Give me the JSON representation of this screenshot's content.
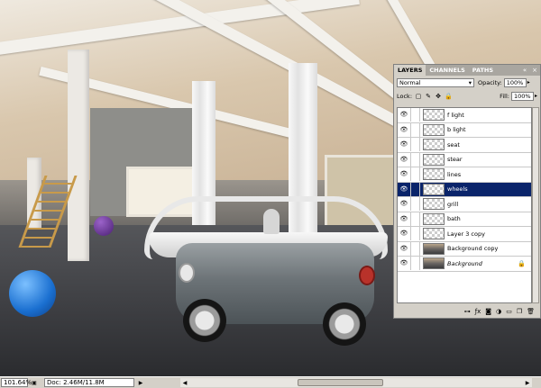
{
  "layers_panel": {
    "tabs": [
      {
        "label": "LAYERS",
        "active": true
      },
      {
        "label": "CHANNELS",
        "active": false
      },
      {
        "label": "PATHS",
        "active": false
      }
    ],
    "blend_mode": "Normal",
    "opacity_label": "Opacity:",
    "opacity_value": "100%",
    "lock_label": "Lock:",
    "fill_label": "Fill:",
    "fill_value": "100%",
    "layers": [
      {
        "name": "f light",
        "thumb": "transparent",
        "selected": false
      },
      {
        "name": "b light",
        "thumb": "transparent",
        "selected": false
      },
      {
        "name": "seat",
        "thumb": "transparent",
        "selected": false
      },
      {
        "name": "stear",
        "thumb": "transparent",
        "selected": false
      },
      {
        "name": "lines",
        "thumb": "transparent",
        "selected": false
      },
      {
        "name": "wheels",
        "thumb": "transparent",
        "selected": true
      },
      {
        "name": "grill",
        "thumb": "transparent",
        "selected": false
      },
      {
        "name": "bath",
        "thumb": "transparent",
        "selected": false
      },
      {
        "name": "Layer 3 copy",
        "thumb": "transparent",
        "selected": false
      },
      {
        "name": "Background copy",
        "thumb": "image",
        "selected": false
      },
      {
        "name": "Background",
        "thumb": "image",
        "selected": false,
        "italic": true,
        "locked": true
      }
    ],
    "bottom_icons": [
      "link-icon",
      "fx-icon",
      "mask-icon",
      "adjustment-icon",
      "folder-icon",
      "new-layer-icon",
      "trash-icon"
    ]
  },
  "status_bar": {
    "zoom": "101.64%",
    "doc_info": "Doc: 2.46M/11.8M"
  },
  "colors": {
    "selection": "#0a246a",
    "panel_bg": "#d4d0c8"
  }
}
